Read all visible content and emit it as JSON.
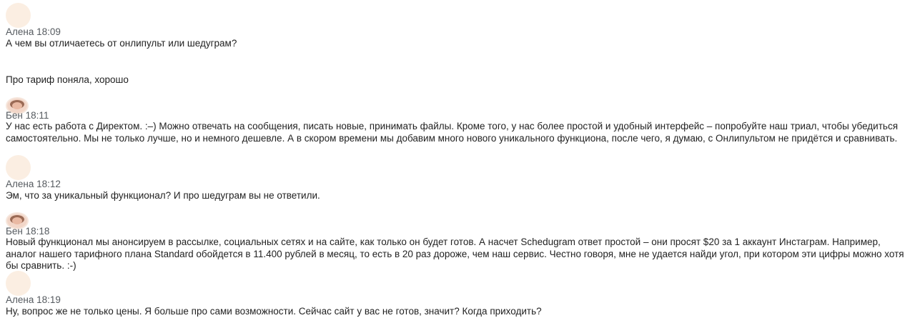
{
  "messages": [
    {
      "author": "Алена",
      "time": "18:09",
      "text": "А чем вы отличаетесь от онлипульт или шедуграм?"
    },
    {
      "author": "",
      "time": "",
      "text": "Про тариф поняла, хорошо"
    },
    {
      "author": "Бен",
      "time": "18:11",
      "text": "У нас есть работа с Директом. :–) Можно отвечать на сообщения, писать новые, принимать файлы. Кроме того, у нас более простой и удобный интерфейс – попробуйте наш триал, чтобы убедиться самостоятельно. Мы не только лучше, но и немного дешевле. А в скором времени мы добавим много нового уникального функциона, после чего, я думаю, с Онлипультом не придётся и сравнивать."
    },
    {
      "author": "Алена",
      "time": "18:12",
      "text": "Эм, что за уникальный функционал? И про шедуграм вы не ответили."
    },
    {
      "author": "Бен",
      "time": "18:18",
      "text": "Новый функционал мы анонсируем в рассылке, социальных сетях и на сайте, как только он будет готов. А насчет Schedugram ответ простой – они просят $20 за 1 аккаунт Инстаграм. Например, аналог нашего тарифного плана Standard обойдется в 11.400 рублей в месяц, то есть в 20 раз дороже, чем наш сервис. Честно говоря, мне не удается найди угол, при котором эти цифры можно хотя бы сравнить. :-)"
    },
    {
      "author": "Алена",
      "time": "18:19",
      "text": "Ну, вопрос же не только цены. Я больше про сами возможности. Сейчас сайт у вас не готов, значит? Когда приходить?"
    }
  ]
}
